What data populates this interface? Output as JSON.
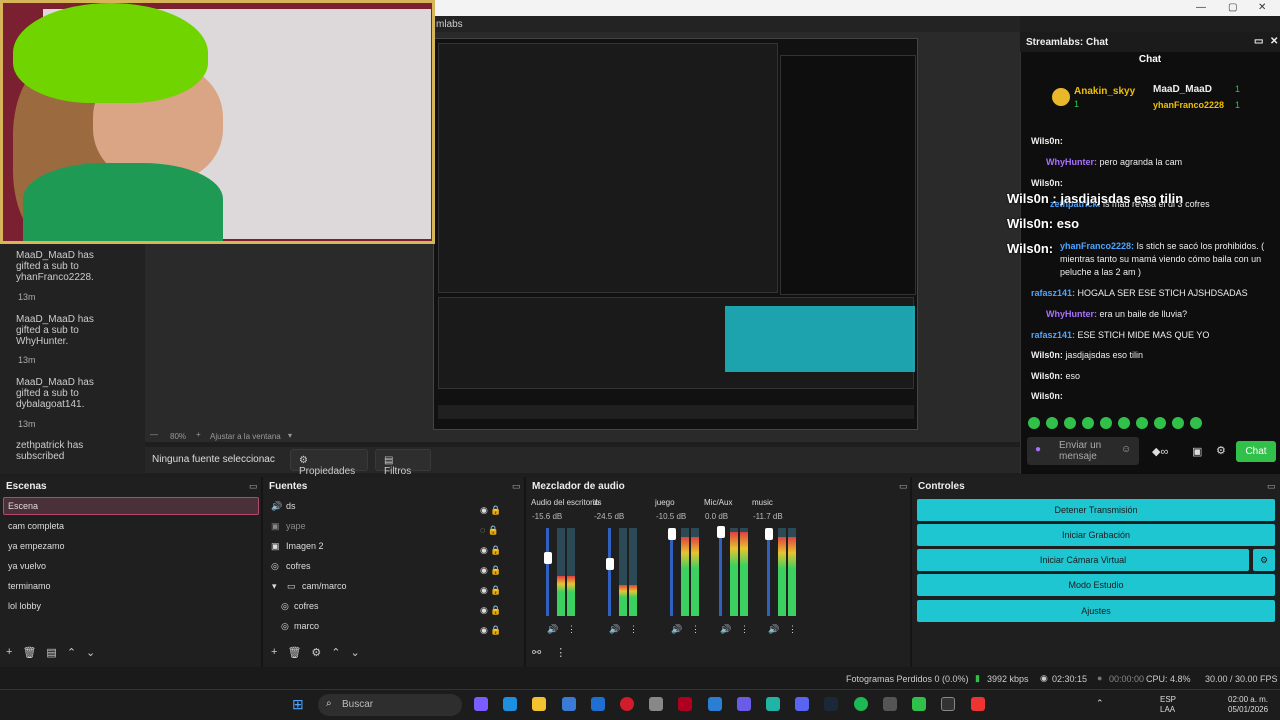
{
  "app": {
    "title_fragment": "mlabs",
    "window_controls": [
      "—",
      "▢",
      "✕"
    ]
  },
  "webcam": {},
  "preview": {
    "zoom": "80%",
    "zoom_mode": "Ajustar a la ventana"
  },
  "source_bar": {
    "no_source": "Ninguna fuente seleccionac",
    "props": "Propiedades",
    "filters": "Filtros"
  },
  "left_chat": [
    {
      "text": "MaaD_MaaD has gifted a sub to yhanFranco2228.",
      "time": "13m"
    },
    {
      "text": "MaaD_MaaD has gifted a sub to WhyHunter.",
      "time": "13m"
    },
    {
      "text": "MaaD_MaaD has gifted a sub to dybalagoat141.",
      "time": "13m"
    },
    {
      "text": "zethpatrick has subscribed",
      "time": ""
    }
  ],
  "right_panel": {
    "title": "Streamlabs: Chat",
    "chat_title": "Chat",
    "top_users": [
      {
        "name": "Anakin_skyy",
        "count": "1"
      },
      {
        "name": "MaaD_MaaD",
        "count": "1"
      },
      {
        "name": "yhanFranco2228",
        "count": "1"
      }
    ],
    "messages": [
      {
        "user": "Wils0n:",
        "text": ""
      },
      {
        "user": "WhyHunter:",
        "text": "pero agranda la cam"
      },
      {
        "user": "Wils0n:",
        "text": ""
      },
      {
        "user": "zethpatrick:",
        "text": "is mad revisa el di 3 cofres"
      },
      {
        "user": "yhanFranco2228:",
        "text": "Is stich se sacó los prohibidos. ( mientras tanto su mamá viendo cómo baila con un peluche a las 2 am )"
      },
      {
        "user": "rafasz141:",
        "text": "HOGALA SER ESE STICH AJSHDSADAS"
      },
      {
        "user": "WhyHunter:",
        "text": "era un baile de lluvia?"
      },
      {
        "user": "rafasz141:",
        "text": "ESE STICH MIDE MAS QUE YO"
      },
      {
        "user": "Wils0n:",
        "text": "jasdjajsdas eso tilin"
      },
      {
        "user": "Wils0n:",
        "text": "eso"
      },
      {
        "user": "Wils0n:",
        "text": ""
      }
    ],
    "overlay_lines": [
      "Wils0n : jasdjajsdas eso tilin",
      "Wils0n: eso",
      "Wils0n:"
    ],
    "input_placeholder": "Enviar un mensaje",
    "send_label": "Chat"
  },
  "scenes": {
    "title": "Escenas",
    "items": [
      "Escena",
      "cam completa",
      "ya empezamo",
      "ya vuelvo",
      "terminamo",
      "lol lobby"
    ]
  },
  "sources": {
    "title": "Fuentes",
    "items": [
      "ds",
      "yape",
      "Imagen 2",
      "cofres",
      "cam/marco",
      "cofres",
      "marco"
    ]
  },
  "mixer": {
    "title": "Mezclador de audio",
    "channels": [
      {
        "name": "Audio del escritorio",
        "db": "-15.6 dB",
        "level": 0.45
      },
      {
        "name": "ds",
        "db": "-24.5 dB",
        "level": 0.35
      },
      {
        "name": "juego",
        "db": "-10.5 dB",
        "level": 0.9
      },
      {
        "name": "Mic/Aux",
        "db": "0.0 dB",
        "level": 0.95
      },
      {
        "name": "music",
        "db": "-11.7 dB",
        "level": 0.9
      }
    ],
    "scale": [
      "0",
      "-5",
      "-10",
      "-15",
      "-20",
      "-25",
      "-30",
      "-35",
      "-40",
      "-45",
      "-50",
      "-55",
      "-60"
    ]
  },
  "controls": {
    "title": "Controles",
    "buttons": [
      "Detener Transmisión",
      "Iniciar Grabación",
      "Iniciar Cámara Virtual",
      "Modo Estudio",
      "Ajustes"
    ]
  },
  "status": {
    "frames": "Fotogramas Perdidos 0 (0.0%)",
    "kbps": "3992 kbps",
    "live_time": "02:30:15",
    "rec_time": "00:00:00",
    "cpu": "CPU: 4.8%",
    "fps": "30.00 / 30.00 FPS"
  },
  "taskbar": {
    "search": "Buscar",
    "lang": "ESP",
    "lang2": "LAA",
    "time": "02:00 a. m.",
    "date": "05/01/2026"
  },
  "colors": {
    "accent": "#1ec6d2",
    "selected_scene": "#b34a6a",
    "chat_button": "#31c04a",
    "username_purple": "#a970ff",
    "username_blue": "#4ea5ff"
  }
}
